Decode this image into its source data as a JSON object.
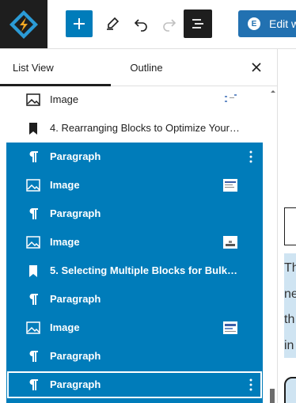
{
  "toolbar": {
    "logo_icon": "wordpress-site-logo-icon",
    "add_icon": "plus-icon",
    "tools_icon": "pencil-icon",
    "undo_icon": "undo-icon",
    "redo_icon": "redo-icon",
    "list_view_icon": "list-view-icon",
    "edit_with_label": "Edit w",
    "edit_with_icon": "elementor-icon",
    "accent_color": "#007cba"
  },
  "panel": {
    "tabs": [
      {
        "label": "List View",
        "active": true
      },
      {
        "label": "Outline",
        "active": false
      }
    ],
    "close_icon": "close-icon"
  },
  "list": {
    "items": [
      {
        "type": "Image",
        "label": "Image",
        "icon": "image-icon",
        "thumb": true,
        "selected": false
      },
      {
        "type": "Heading",
        "label": "4. Rearranging Blocks to Optimize Your ...",
        "icon": "bookmark-icon",
        "selected": false
      },
      {
        "type": "Paragraph",
        "label": "Paragraph",
        "icon": "paragraph-icon",
        "selected": true,
        "options": true
      },
      {
        "type": "Image",
        "label": "Image",
        "icon": "image-icon",
        "thumb": true,
        "selected": true
      },
      {
        "type": "Paragraph",
        "label": "Paragraph",
        "icon": "paragraph-icon",
        "selected": true
      },
      {
        "type": "Image",
        "label": "Image",
        "icon": "image-icon",
        "thumb": true,
        "selected": true
      },
      {
        "type": "Heading",
        "label": "5. Selecting Multiple Blocks for Bulk Edi...",
        "icon": "bookmark-icon",
        "selected": true
      },
      {
        "type": "Paragraph",
        "label": "Paragraph",
        "icon": "paragraph-icon",
        "selected": true
      },
      {
        "type": "Image",
        "label": "Image",
        "icon": "image-icon",
        "thumb": true,
        "selected": true
      },
      {
        "type": "Paragraph",
        "label": "Paragraph",
        "icon": "paragraph-icon",
        "selected": true
      },
      {
        "type": "Paragraph",
        "label": "Paragraph",
        "icon": "paragraph-icon",
        "selected": true,
        "focused": true,
        "options": true
      }
    ]
  },
  "canvas": {
    "lines": [
      "Th",
      "ne",
      "th",
      "in"
    ]
  }
}
